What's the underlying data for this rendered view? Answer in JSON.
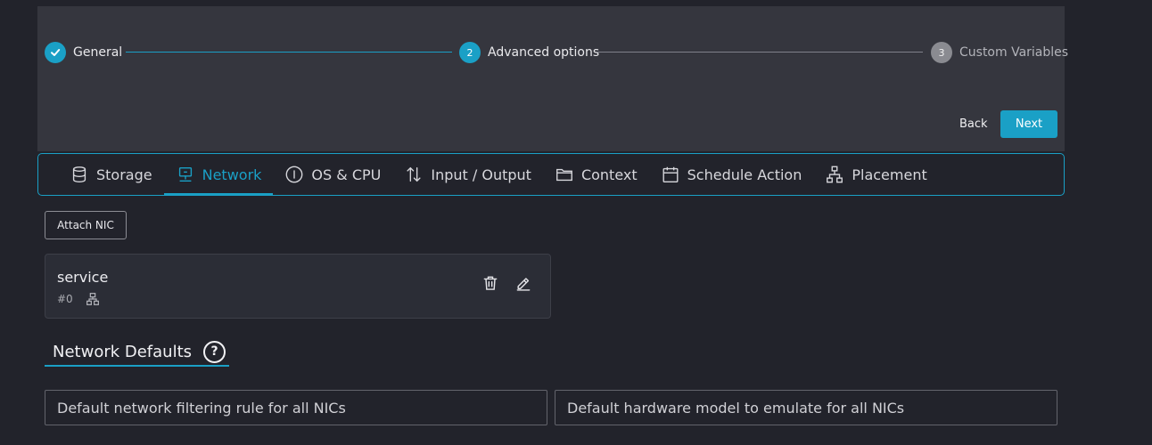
{
  "stepper": {
    "steps": [
      {
        "number": "1",
        "label": "General",
        "state": "done"
      },
      {
        "number": "2",
        "label": "Advanced options",
        "state": "active"
      },
      {
        "number": "3",
        "label": "Custom Variables",
        "state": "pending"
      }
    ],
    "back_label": "Back",
    "next_label": "Next"
  },
  "tabs": [
    {
      "label": "Storage",
      "icon": "database-icon"
    },
    {
      "label": "Network",
      "icon": "network-icon",
      "active": true
    },
    {
      "label": "OS & CPU",
      "icon": "info-icon"
    },
    {
      "label": "Input / Output",
      "icon": "arrows-up-down-icon"
    },
    {
      "label": "Context",
      "icon": "folder-icon"
    },
    {
      "label": "Schedule Action",
      "icon": "calendar-icon"
    },
    {
      "label": "Placement",
      "icon": "hierarchy-icon"
    }
  ],
  "actions": {
    "attach_nic_label": "Attach NIC"
  },
  "nic": {
    "name": "service",
    "index": "#0",
    "delete_icon": "trash-icon",
    "edit_icon": "pencil-icon"
  },
  "network_defaults": {
    "title": "Network Defaults",
    "help_icon": "help-icon",
    "filter_placeholder": "Default network filtering rule for all NICs",
    "model_placeholder": "Default hardware model to emulate for all NICs"
  },
  "colors": {
    "accent": "#1aa0c6",
    "background": "#22232b",
    "panel": "#35363e"
  }
}
